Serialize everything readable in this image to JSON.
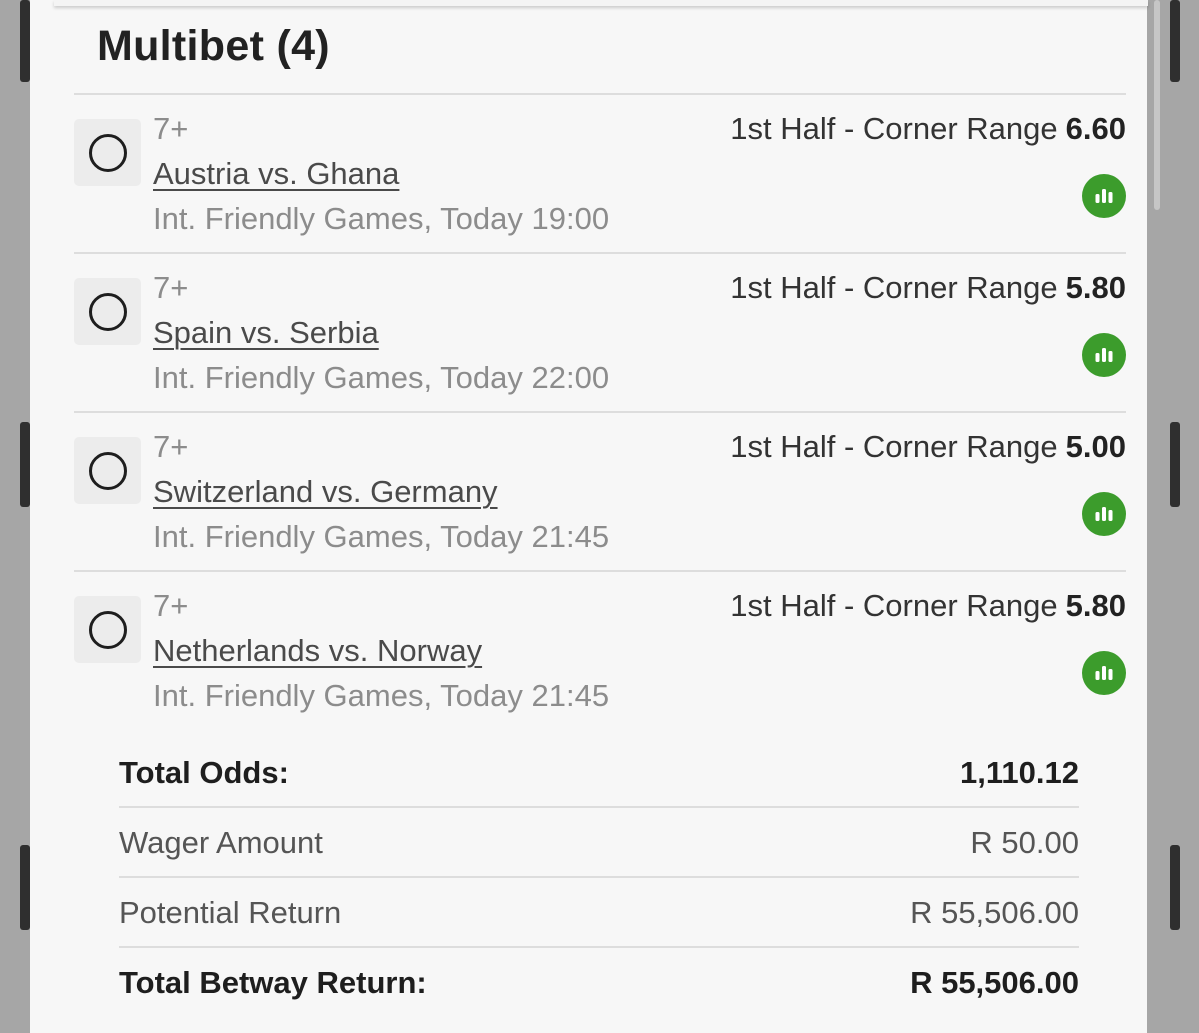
{
  "betslip": {
    "title": "Multibet (4)",
    "legs": [
      {
        "selection": "7+",
        "match": "Austria vs. Ghana",
        "league_time": "Int. Friendly Games, Today 19:00",
        "market": "1st Half - Corner Range",
        "odds": "6.60"
      },
      {
        "selection": "7+",
        "match": "Spain vs. Serbia",
        "league_time": "Int. Friendly Games, Today 22:00",
        "market": "1st Half - Corner Range",
        "odds": "5.80"
      },
      {
        "selection": "7+",
        "match": "Switzerland vs. Germany",
        "league_time": "Int. Friendly Games, Today 21:45",
        "market": "1st Half - Corner Range",
        "odds": "5.00"
      },
      {
        "selection": "7+",
        "match": "Netherlands vs. Norway",
        "league_time": "Int. Friendly Games, Today 21:45",
        "market": "1st Half - Corner Range",
        "odds": "5.80"
      }
    ],
    "summary": {
      "total_odds_label": "Total Odds:",
      "total_odds_value": "1,110.12",
      "wager_label": "Wager Amount",
      "wager_value": "R 50.00",
      "potential_label": "Potential Return",
      "potential_value": "R 55,506.00",
      "betway_label": "Total Betway Return:",
      "betway_value": "R 55,506.00"
    }
  },
  "icons": {
    "leg_select": "radio-circle-icon",
    "leg_stats": "bar-chart-icon"
  },
  "colors": {
    "stats_green": "#3c9c2c",
    "background": "#f7f7f7"
  }
}
